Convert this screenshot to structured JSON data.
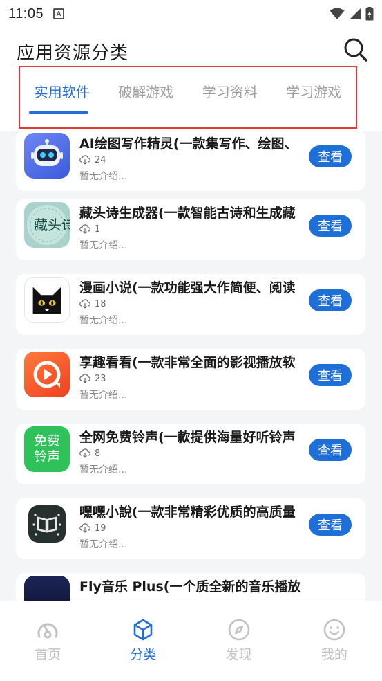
{
  "status_bar": {
    "time": "11:05",
    "app_icon_letter": "A"
  },
  "header": {
    "title": "应用资源分类"
  },
  "tabs": [
    {
      "label": "实用软件",
      "active": true
    },
    {
      "label": "破解游戏",
      "active": false
    },
    {
      "label": "学习资料",
      "active": false
    },
    {
      "label": "学习游戏",
      "active": false
    }
  ],
  "apps": [
    {
      "name": "AI绘图写作精灵(一款集写作、绘图、",
      "downloads": "24",
      "desc": "暂无介绍...",
      "button": "查看",
      "icon": "robot-icon"
    },
    {
      "name": "藏头诗生成器(一款智能古诗和生成藏",
      "downloads": "1",
      "desc": "暂无介绍...",
      "button": "查看",
      "icon": "poem-icon",
      "icon_text": "藏头诗"
    },
    {
      "name": "漫画小说(一款功能强大作简便、阅读",
      "downloads": "18",
      "desc": "暂无介绍...",
      "button": "查看",
      "icon": "cat-icon"
    },
    {
      "name": "享趣看看(一款非常全面的影视播放软",
      "downloads": "23",
      "desc": "暂无介绍...",
      "button": "查看",
      "icon": "play-icon"
    },
    {
      "name": "全网免费铃声(一款提供海量好听铃声",
      "downloads": "8",
      "desc": "暂无介绍...",
      "button": "查看",
      "icon": "ringtone-icon",
      "icon_text": "免费铃声"
    },
    {
      "name": "嘿嘿小說(一款非常精彩优质的高质量",
      "downloads": "19",
      "desc": "暂无介绍...",
      "button": "查看",
      "icon": "book-icon"
    },
    {
      "name": "Fly音乐 Plus(一个质全新的音乐播放",
      "downloads": "",
      "desc": "",
      "button": "",
      "icon": "music-icon"
    }
  ],
  "bottom_nav": [
    {
      "label": "首页",
      "icon": "home-icon",
      "active": false
    },
    {
      "label": "分类",
      "icon": "category-icon",
      "active": true
    },
    {
      "label": "发现",
      "icon": "compass-icon",
      "active": false
    },
    {
      "label": "我的",
      "icon": "smile-icon",
      "active": false
    }
  ],
  "colors": {
    "accent": "#1f6fd8",
    "highlight_border": "#e53935",
    "inactive": "#9e9e9e",
    "background": "#f4f5f7"
  }
}
